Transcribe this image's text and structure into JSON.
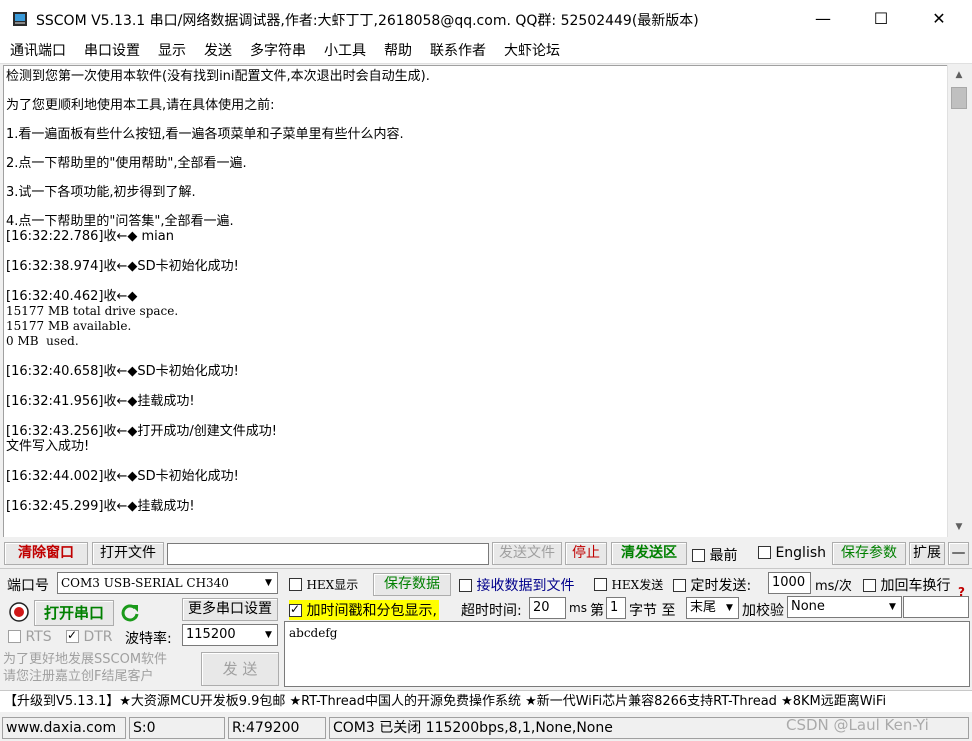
{
  "window": {
    "title": "SSCOM V5.13.1 串口/网络数据调试器,作者:大虾丁丁,2618058@qq.com. QQ群: 52502449(最新版本)",
    "minimize": "—",
    "maximize": "☐",
    "close": "✕"
  },
  "menu": [
    "通讯端口",
    "串口设置",
    "显示",
    "发送",
    "多字符串",
    "小工具",
    "帮助",
    "联系作者",
    "大虾论坛"
  ],
  "recv": {
    "intro": [
      "检测到您第一次使用本软件(没有找到ini配置文件,本次退出时会自动生成).",
      "为了您更顺利地使用本工具,请在具体使用之前:",
      "1.看一遍面板有些什么按钮,看一遍各项菜单和子菜单里有些什么内容.",
      "2.点一下帮助里的\"使用帮助\",全部看一遍.",
      "3.试一下各项功能,初步得到了解.",
      "4.点一下帮助里的\"问答集\",全部看一遍."
    ],
    "log1": "[16:32:22.786]收←◆ mian",
    "log2": "[16:32:38.974]收←◆SD卡初始化成功!",
    "log3": "[16:32:40.462]收←◆",
    "log3a": "15177 MB total drive space.",
    "log3b": "15177 MB available.",
    "log3c": "0 MB  used.",
    "log4": "[16:32:40.658]收←◆SD卡初始化成功!",
    "log5": "[16:32:41.956]收←◆挂载成功!",
    "log6": "[16:32:43.256]收←◆打开成功/创建文件成功!",
    "log6a": "文件写入成功!",
    "log7": "[16:32:44.002]收←◆SD卡初始化成功!",
    "log8": "[16:32:45.299]收←◆挂载成功!"
  },
  "toolbar": {
    "clear": "清除窗口",
    "open_file": "打开文件",
    "file_path": "",
    "send_file": "发送文件",
    "stop": "停止",
    "clear_send": "清发送区",
    "topmost": "最前",
    "english": "English",
    "save_params": "保存参数",
    "expand": "扩展",
    "collapse": "—"
  },
  "port": {
    "label": "端口号",
    "value": "COM3 USB-SERIAL CH340",
    "open_port": "打开串口",
    "more_settings": "更多串口设置",
    "rts": "RTS",
    "dtr": "DTR",
    "baud_label": "波特率:",
    "baud": "115200"
  },
  "options": {
    "hex_show": "HEX显示",
    "save_data": "保存数据",
    "recv_to_file": "接收数据到文件",
    "hex_send": "HEX发送",
    "timed_send": "定时发送:",
    "interval": "1000",
    "interval_unit": "ms/次",
    "add_crlf": "加回车换行",
    "timestamp": "加时间戳和分包显示,",
    "timeout_label": "超时时间:",
    "timeout": "20",
    "timeout_unit": "ms",
    "byte_prefix": "第",
    "byte_index": "1",
    "byte_suffix": "字节 至",
    "byte_end": "末尾",
    "checksum_label": "加校验",
    "checksum": "None",
    "help_q": "?"
  },
  "send": {
    "text": "abcdefg",
    "button": "发 送",
    "promo": "为了更好地发展SSCOM软件\n请您注册嘉立创F结尾客户"
  },
  "ticker": "【升级到V5.13.1】★大资源MCU开发板9.9包邮 ★RT-Thread中国人的开源免费操作系统 ★新一代WiFi芯片兼容8266支持RT-Thread ★8KM远距离WiFi",
  "status": {
    "site": "www.daxia.com",
    "sent": "S:0",
    "received": "R:479200",
    "port_state": "COM3 已关闭  115200bps,8,1,None,None"
  },
  "watermark": "CSDN @Laul Ken-Yi",
  "colors": {
    "timestamp_bg": "#ffff00",
    "save_green": "#008000",
    "clear_red": "#c00000"
  }
}
